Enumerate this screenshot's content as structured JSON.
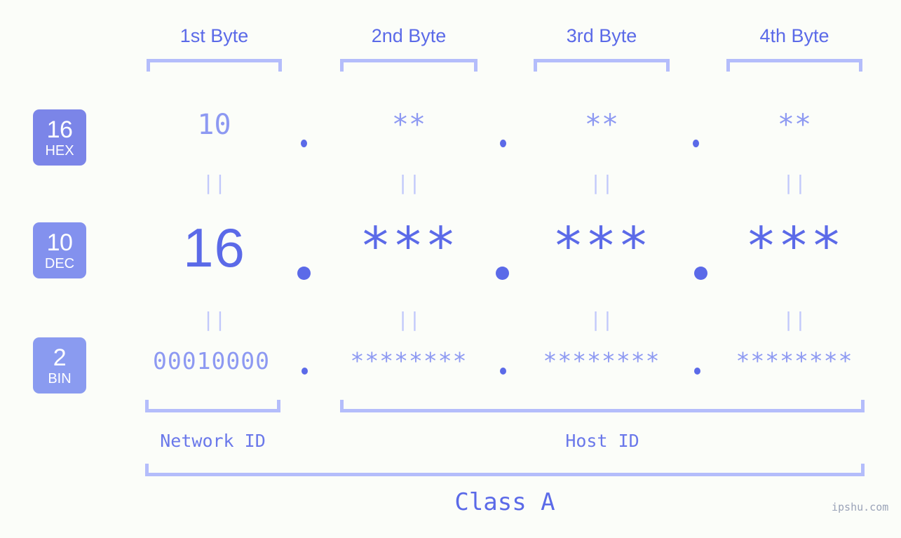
{
  "background_color": "#fbfdf9",
  "accent_color": "#5b6ae8",
  "light_accent_color": "#8d99f2",
  "bracket_color": "#b4bdfb",
  "byte_headers": [
    {
      "label": "1st Byte"
    },
    {
      "label": "2nd Byte"
    },
    {
      "label": "3rd Byte"
    },
    {
      "label": "4th Byte"
    }
  ],
  "rows": [
    {
      "badge_number": "16",
      "badge_name": "HEX",
      "badge_color": "#7b85e8",
      "values": [
        "10",
        "**",
        "**",
        "**"
      ],
      "separator": "."
    },
    {
      "badge_number": "10",
      "badge_name": "DEC",
      "badge_color": "#8391ee",
      "values": [
        "16",
        "***",
        "***",
        "***"
      ],
      "separator": "."
    },
    {
      "badge_number": "2",
      "badge_name": "BIN",
      "badge_color": "#8a9bf0",
      "values": [
        "00010000",
        "********",
        "********",
        "********"
      ],
      "separator": "."
    }
  ],
  "equals_marks": [
    "||",
    "||",
    "||",
    "||"
  ],
  "id_sections": [
    {
      "label": "Network ID"
    },
    {
      "label": "Host ID"
    }
  ],
  "class_label": "Class A",
  "watermark": "ipshu.com"
}
